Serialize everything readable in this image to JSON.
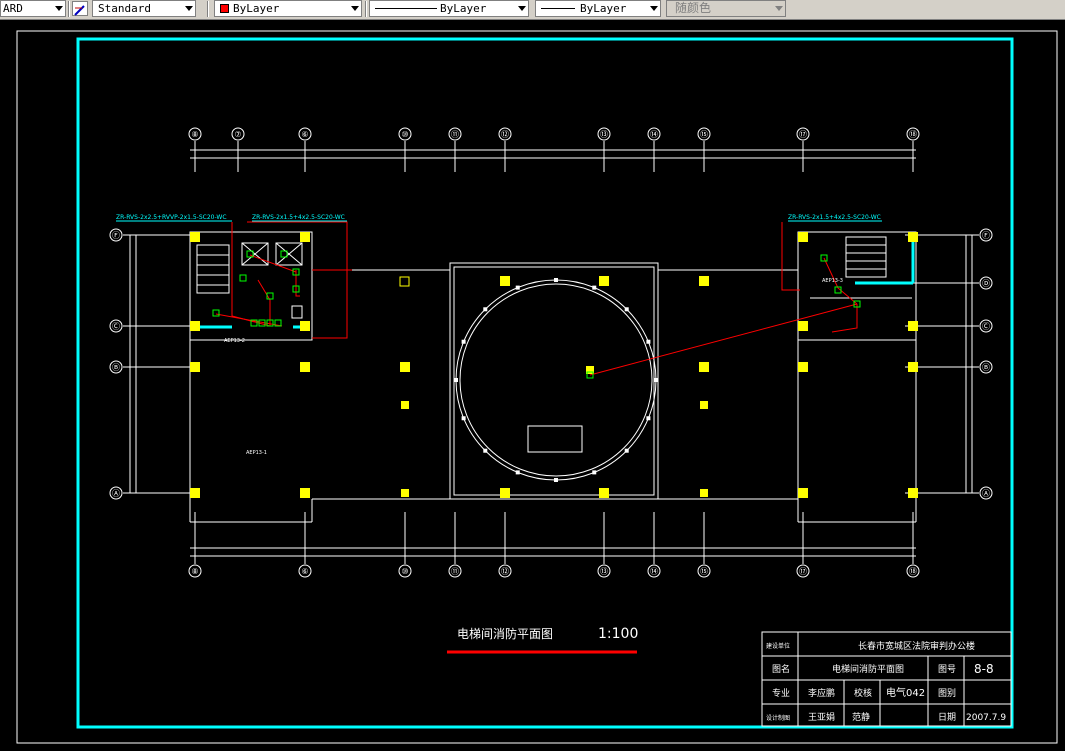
{
  "toolbar": {
    "textstyle_partial": "ARD",
    "dimstyle": "Standard",
    "color": "ByLayer",
    "linetype": "ByLayer",
    "lineweight": "ByLayer",
    "plotstyle": "随颜色",
    "color_swatch": "#ff0000"
  },
  "drawing": {
    "grid_top": [
      "⑧",
      "⑦",
      "⑥",
      "⑩",
      "⑪",
      "⑫",
      "⑬",
      "⑭",
      "⑮",
      "⑰",
      "⑱"
    ],
    "grid_bottom": [
      "⑧",
      "⑥",
      "⑩",
      "⑪",
      "⑫",
      "⑬",
      "⑭",
      "⑮",
      "⑰",
      "⑱"
    ],
    "grid_left": [
      "Ⓕ",
      "Ⓒ",
      "Ⓑ",
      "Ⓐ"
    ],
    "grid_right": [
      "Ⓕ",
      "Ⓓ",
      "Ⓒ",
      "Ⓑ",
      "Ⓐ"
    ],
    "cable_left_1": "ZR-RVS-2x2.5+RVVP-2x1.5-SC20-WC",
    "cable_left_2": "ZR-RVS-2x1.5+4x2.5-SC20-WC",
    "cable_right": "ZR-RVS-2x1.5+4x2.5-SC20-WC",
    "panel_left": "AEP13-2",
    "panel_right": "AEP13-3",
    "panel_main": "AEP13-1",
    "caption": "电梯间消防平面图",
    "scale": "1:100"
  },
  "title_block": {
    "project_label": "建设单位",
    "project": "长春市宽城区法院审判办公楼",
    "drawing_name_label": "图名",
    "drawing_name": "电梯间消防平面图",
    "drawing_no_label": "图号",
    "drawing_no": "8-8",
    "discipline_label": "专业",
    "designer": "李应鹏",
    "check_label": "校核",
    "code": "电气042",
    "scale_label": "图别",
    "reviewer_label": "设计制图",
    "reviewer": "王亚娟",
    "approver": "范静",
    "date_label": "日期",
    "date": "2007.7.9"
  },
  "colors": {
    "frame": "#00ffff",
    "wall": "#ffffff",
    "column": "#ffff00",
    "cable": "#ff0000",
    "device": "#00ff00"
  }
}
